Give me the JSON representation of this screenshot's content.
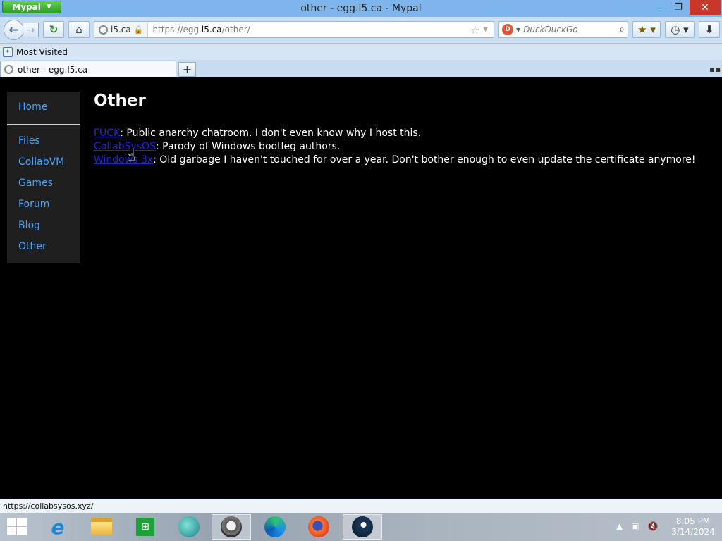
{
  "window": {
    "app_menu_label": "Mypal",
    "title": "other - egg.l5.ca - Mypal",
    "minimize_glyph": "—",
    "maximize_glyph": "❐",
    "close_glyph": "✕"
  },
  "navbar": {
    "site_identity": "l5.ca",
    "url_prefix": "https://egg.",
    "url_domain": "l5.ca",
    "url_path": "/other/",
    "search_placeholder": "DuckDuckGo"
  },
  "bookmarks": {
    "most_visited_label": "Most Visited"
  },
  "tabs": [
    {
      "title": "other - egg.l5.ca"
    }
  ],
  "page": {
    "nav": {
      "home": "Home",
      "items": [
        "Files",
        "CollabVM",
        "Games",
        "Forum",
        "Blog",
        "Other"
      ]
    },
    "heading": "Other",
    "entries": [
      {
        "link": "FUCK",
        "desc": ": Public anarchy chatroom. I don't even know why I host this."
      },
      {
        "link": "CollabSysOS",
        "desc": ": Parody of Windows bootleg authors."
      },
      {
        "link": "Windows 3x",
        "desc": ": Old garbage I haven't touched for over a year. Don't bother enough to even update the certificate anymore!"
      }
    ]
  },
  "statusbar": {
    "text": "https://collabsysos.xyz/"
  },
  "taskbar": {
    "time": "8:05 PM",
    "date": "3/14/2024"
  },
  "colors": {
    "link": "#4aa3ff",
    "entry_link": "#1d27d6",
    "page_bg": "#000000",
    "sidebar_bg": "#1f1f1f",
    "close_button": "#c7372a",
    "menu_button": "#2e9f26"
  }
}
